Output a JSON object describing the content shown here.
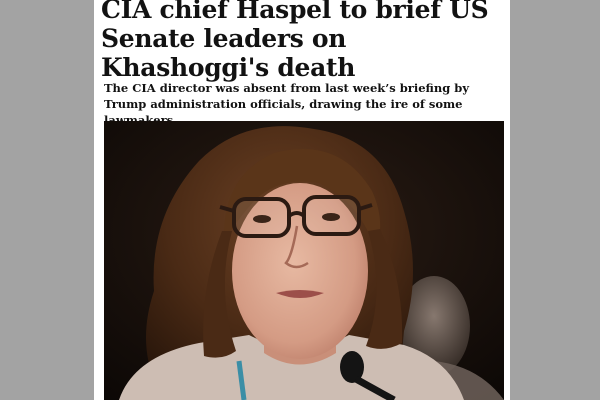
{
  "article": {
    "headline": "CIA chief Haspel to brief US Senate leaders on Khashoggi's death",
    "standfirst": "The CIA director was absent from last week’s briefing by Trump administration officials, drawing the ire of some lawmakers"
  },
  "photo": {
    "subject": "woman-with-glasses-at-microphone"
  },
  "colors": {
    "backdrop": "#a3a3a3",
    "article_background": "#ffffff",
    "text": "#121212"
  }
}
